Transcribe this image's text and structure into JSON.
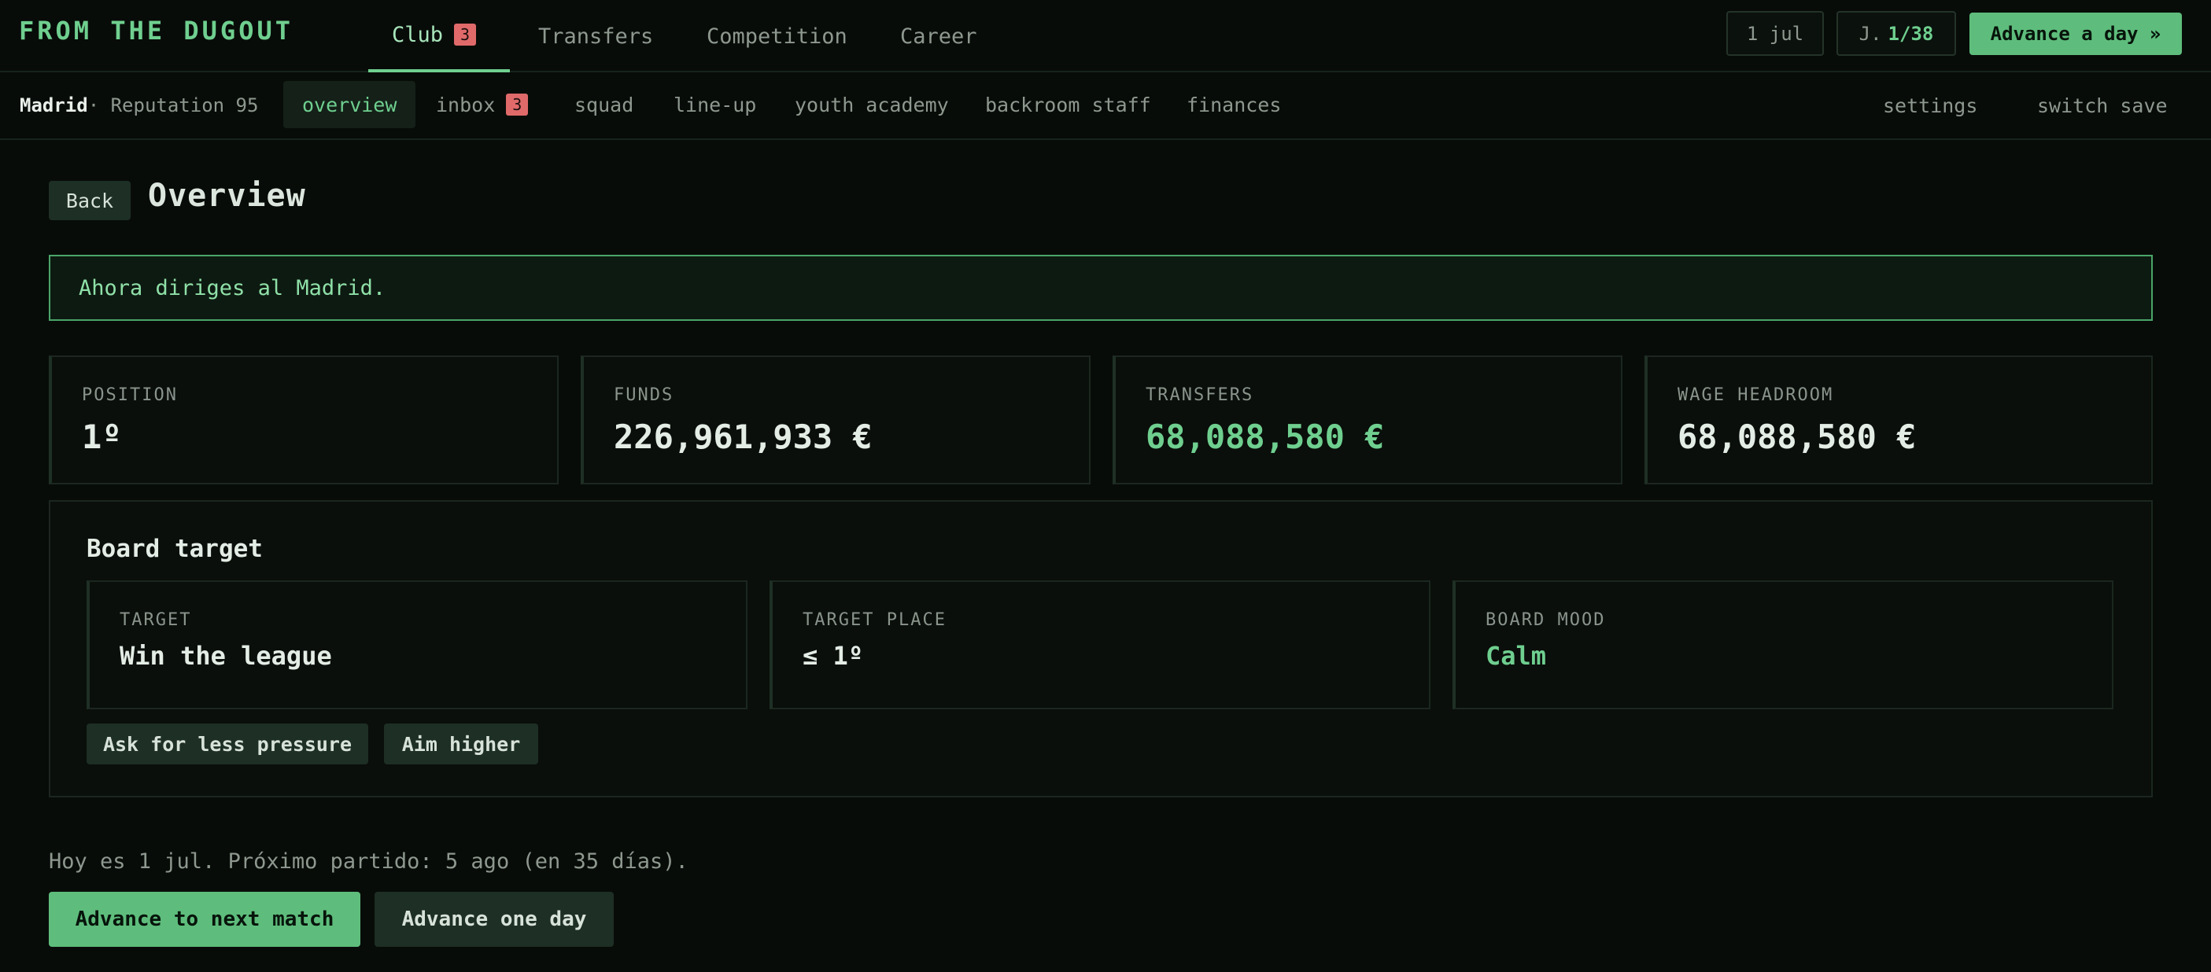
{
  "app": {
    "title": "FROM THE DUGOUT"
  },
  "top_tabs": [
    {
      "label": "Club",
      "badge": "3"
    },
    {
      "label": "Transfers"
    },
    {
      "label": "Competition"
    },
    {
      "label": "Career"
    }
  ],
  "top_right": {
    "date": "1 jul",
    "matchday_prefix": "J.",
    "matchday": "1/38",
    "advance_label": "Advance a day »"
  },
  "club": {
    "name": "Madrid",
    "reputation": "· Reputation 95"
  },
  "sub_tabs": [
    {
      "label": "overview",
      "active": true
    },
    {
      "label": "inbox",
      "badge": "3"
    },
    {
      "label": "squad"
    },
    {
      "label": "line-up"
    },
    {
      "label": "youth academy"
    },
    {
      "label": "backroom staff"
    },
    {
      "label": "finances"
    }
  ],
  "sub_right": {
    "settings": "settings",
    "switch_save": "switch save"
  },
  "page": {
    "back": "Back",
    "title": "Overview"
  },
  "notice": "Ahora diriges al Madrid.",
  "stats": [
    {
      "label": "POSITION",
      "value": "1º"
    },
    {
      "label": "FUNDS",
      "value": "226,961,933 €"
    },
    {
      "label": "TRANSFERS",
      "value": "68,088,580 €"
    },
    {
      "label": "WAGE HEADROOM",
      "value": "68,088,580 €"
    }
  ],
  "board": {
    "title": "Board target",
    "cards": [
      {
        "label": "TARGET",
        "value": "Win the league"
      },
      {
        "label": "TARGET PLACE",
        "value": "≤ 1º"
      },
      {
        "label": "BOARD MOOD",
        "value": "Calm"
      }
    ],
    "buttons": [
      "Ask for less pressure",
      "Aim higher"
    ]
  },
  "footer": {
    "today": "Hoy es 1 jul. Próximo partido: 5 ago (en 35 días).",
    "next_match": "Advance to next match",
    "one_day": "Advance one day"
  },
  "colors": {
    "accent": "#6fcf8f",
    "badge": "#e06a6a",
    "background": "#080c09"
  }
}
